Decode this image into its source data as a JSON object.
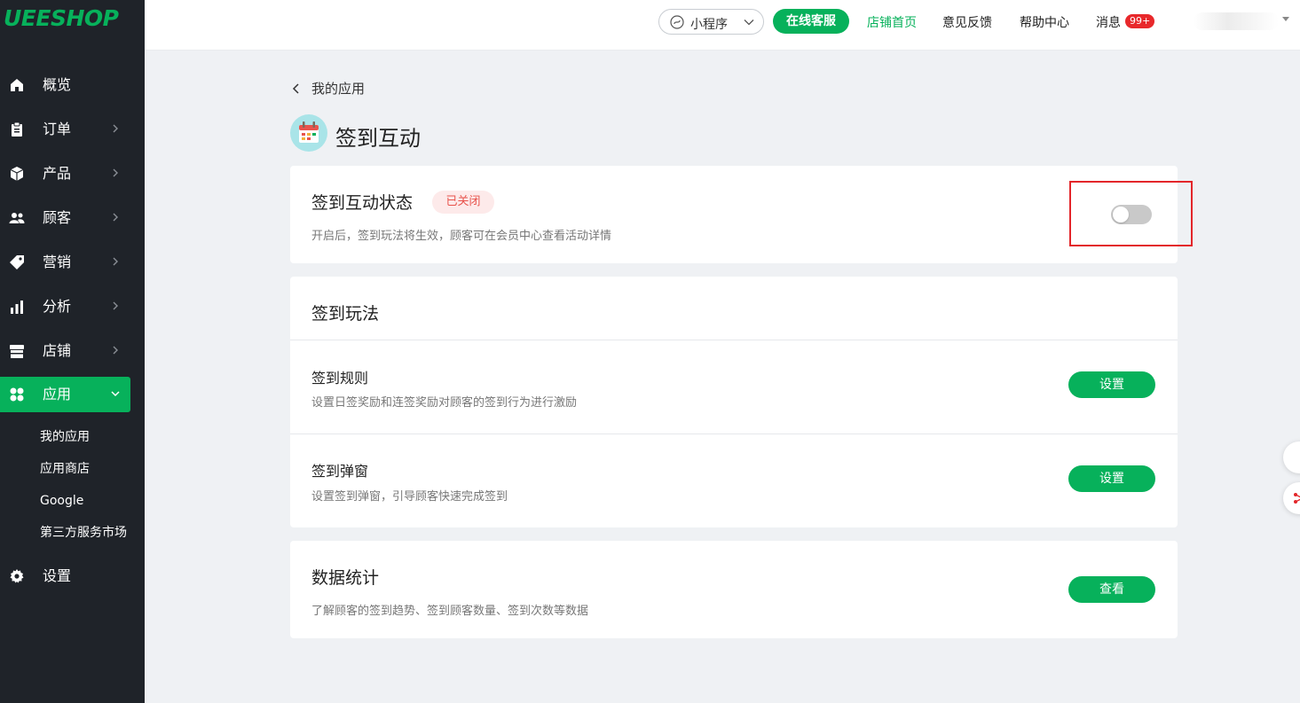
{
  "brand": {
    "logo": "UEESHOP",
    "accent": "#07b15b"
  },
  "sidebar": {
    "items": [
      {
        "label": "概览",
        "icon": "home-icon"
      },
      {
        "label": "订单",
        "icon": "clipboard-icon"
      },
      {
        "label": "产品",
        "icon": "box-icon"
      },
      {
        "label": "顾客",
        "icon": "users-icon"
      },
      {
        "label": "营销",
        "icon": "tag-icon"
      },
      {
        "label": "分析",
        "icon": "bar-chart-icon"
      },
      {
        "label": "店铺",
        "icon": "store-icon"
      },
      {
        "label": "应用",
        "icon": "apps-icon"
      },
      {
        "label": "设置",
        "icon": "gear-icon"
      }
    ],
    "sub_items": [
      "我的应用",
      "应用商店",
      "Google",
      "第三方服务市场"
    ]
  },
  "topbar": {
    "mini_program": "小程序",
    "online_service": "在线客服",
    "links": [
      "店铺首页",
      "意见反馈",
      "帮助中心",
      "消息"
    ],
    "message_badge": "99+"
  },
  "main": {
    "back_label": "我的应用",
    "app_title": "签到互动",
    "status_card": {
      "title": "签到互动状态",
      "status": "已关闭",
      "description": "开启后，签到玩法将生效，顾客可在会员中心查看活动详情",
      "enabled": false
    },
    "play_card": {
      "title": "签到玩法",
      "sections": [
        {
          "title": "签到规则",
          "description": "设置日签奖励和连签奖励对顾客的签到行为进行激励",
          "button": "设置"
        },
        {
          "title": "签到弹窗",
          "description": "设置签到弹窗，引导顾客快速完成签到",
          "button": "设置"
        }
      ]
    },
    "stats_card": {
      "title": "数据统计",
      "description": "了解顾客的签到趋势、签到顾客数量、签到次数等数据",
      "button": "查看"
    }
  }
}
